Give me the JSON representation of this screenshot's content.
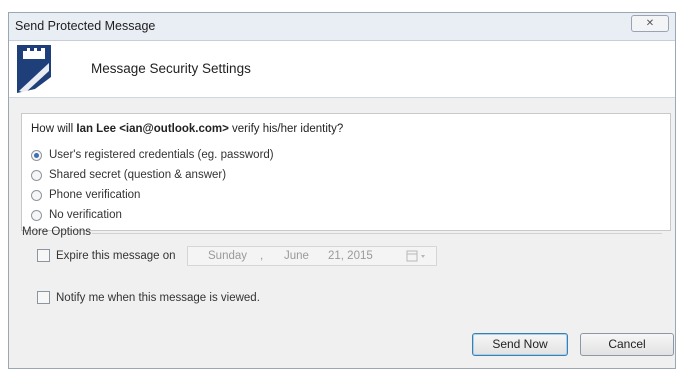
{
  "window": {
    "title": "Send Protected Message",
    "close_glyph": "✕"
  },
  "header": {
    "title": "Message Security Settings",
    "logo_icon": "castle-shield-icon"
  },
  "question": {
    "prefix": "How will ",
    "recipient_name": "Ian Lee",
    "recipient_email": "<ian@outlook.com>",
    "suffix": " verify his/her identity?"
  },
  "verification_options": [
    {
      "label": "User's registered credentials (eg. password)",
      "selected": true
    },
    {
      "label": "Shared secret (question & answer)",
      "selected": false
    },
    {
      "label": "Phone verification",
      "selected": false
    },
    {
      "label": "No verification",
      "selected": false
    }
  ],
  "more_options": {
    "section_label": "More Options",
    "expire_label": "Expire this message on",
    "expire_checked": false,
    "expire_date": {
      "weekday": "Sunday",
      "comma": ",",
      "month": "June",
      "day_year": "21, 2015",
      "picker_icon": "calendar-dropdown-icon"
    },
    "notify_label": "Notify me when this message is viewed.",
    "notify_checked": false
  },
  "buttons": {
    "send": "Send Now",
    "cancel": "Cancel"
  },
  "colors": {
    "accent": "#1f3f7a",
    "selection": "#3b6fb6"
  }
}
